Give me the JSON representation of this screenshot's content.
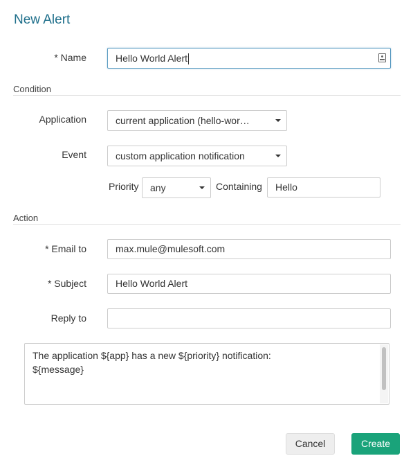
{
  "dialog": {
    "title": "New Alert"
  },
  "form": {
    "name_label": "* Name",
    "name_value": "Hello World Alert",
    "condition_section": "Condition",
    "application_label": "Application",
    "application_value": "current application (hello-wor…",
    "event_label": "Event",
    "event_value": "custom application notification",
    "priority_label": "Priority",
    "priority_value": "any",
    "containing_label": "Containing",
    "containing_value": "Hello",
    "action_section": "Action",
    "email_label": "* Email to",
    "email_value": "max.mule@mulesoft.com",
    "subject_label": "* Subject",
    "subject_value": "Hello World Alert",
    "reply_label": "Reply to",
    "reply_value": "",
    "message_lines": [
      "The application ${app} has a new ${priority} notification:",
      "",
      "${message}"
    ]
  },
  "buttons": {
    "cancel": "Cancel",
    "create": "Create"
  },
  "colors": {
    "title": "#1f6f8b",
    "create_button": "#1aa37a",
    "focus_border": "#5a9bc2"
  },
  "icons": {
    "name_field_icon": "contact-card-icon",
    "dropdown_icon": "caret-down-icon"
  }
}
